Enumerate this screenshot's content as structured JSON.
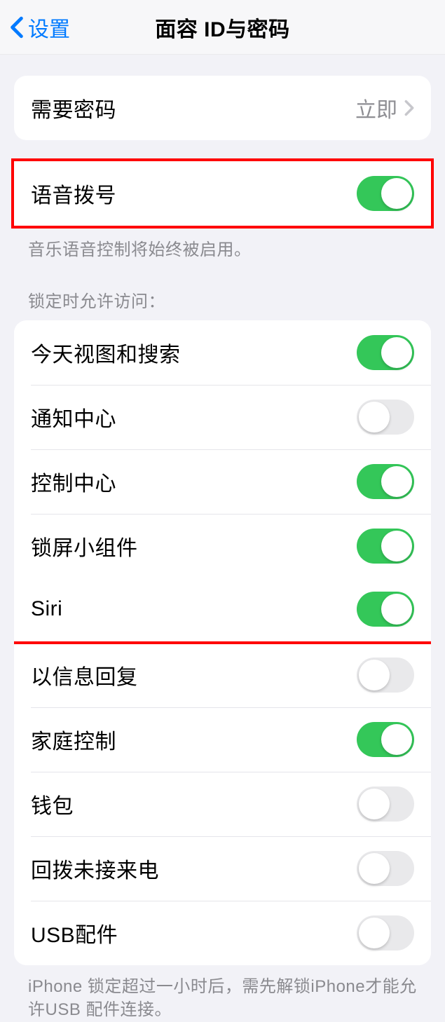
{
  "nav": {
    "back": "设置",
    "title": "面容 ID与密码"
  },
  "require_passcode": {
    "label": "需要密码",
    "value": "立即"
  },
  "voice_dial": {
    "label": "语音拨号",
    "on": true,
    "footer": "音乐语音控制将始终被启用。"
  },
  "lock_access": {
    "header": "锁定时允许访问：",
    "items": [
      {
        "label": "今天视图和搜索",
        "on": true
      },
      {
        "label": "通知中心",
        "on": false
      },
      {
        "label": "控制中心",
        "on": true
      },
      {
        "label": "锁屏小组件",
        "on": true
      },
      {
        "label": "Siri",
        "on": true,
        "highlight": true
      },
      {
        "label": "以信息回复",
        "on": false
      },
      {
        "label": "家庭控制",
        "on": true
      },
      {
        "label": "钱包",
        "on": false
      },
      {
        "label": "回拨未接来电",
        "on": false
      },
      {
        "label": "USB配件",
        "on": false
      }
    ],
    "footer": "iPhone 锁定超过一小时后，需先解锁iPhone才能允许USB 配件连接。"
  }
}
